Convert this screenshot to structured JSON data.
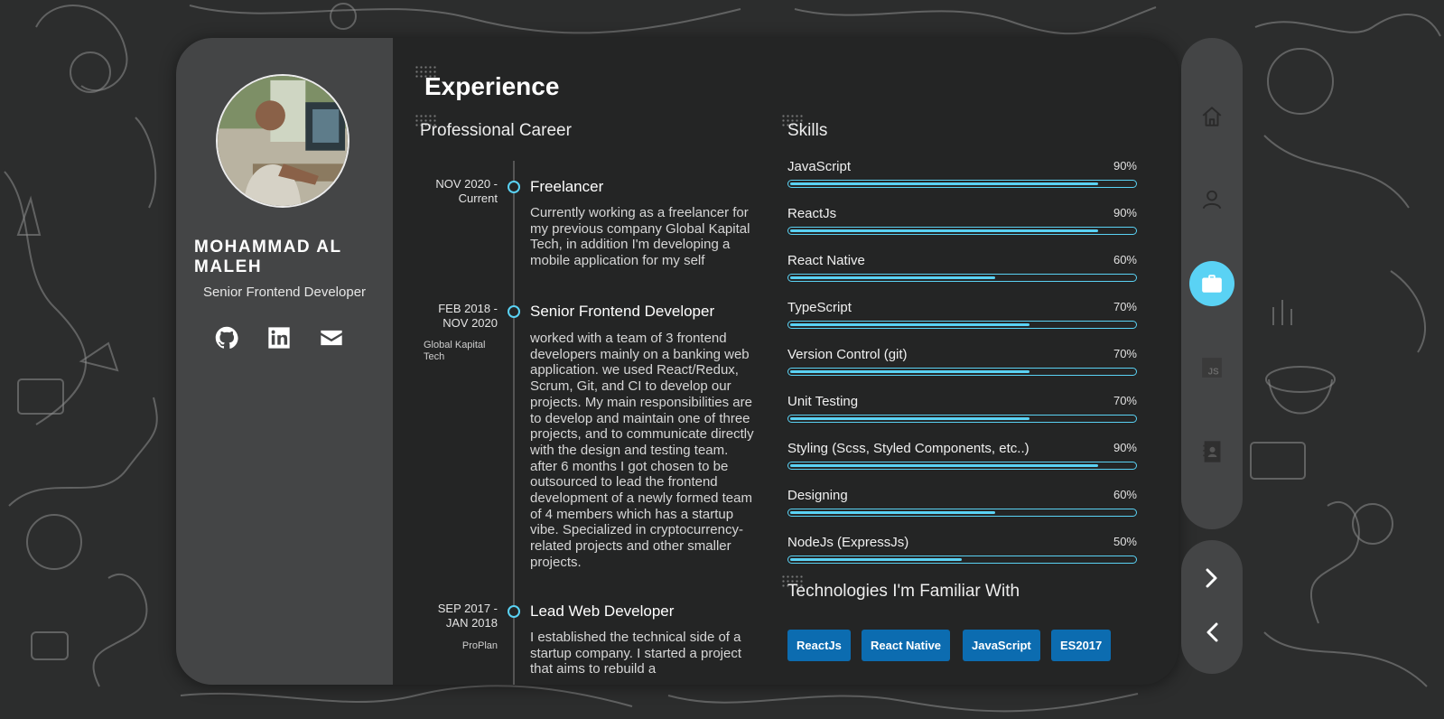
{
  "profile": {
    "name": "MOHAMMAD AL MALEH",
    "role": "Senior Frontend Developer",
    "socials": [
      "github-icon",
      "linkedin-icon",
      "mail-icon"
    ]
  },
  "experience": {
    "title": "Experience",
    "career_title": "Professional Career",
    "items": [
      {
        "date": "NOV 2020 - Current",
        "company": "",
        "title": "Freelancer",
        "desc": "Currently working as a freelancer for my previous company Global Kapital Tech, in addition I'm developing a mobile application for my self"
      },
      {
        "date": "FEB 2018 - NOV 2020",
        "company": "Global Kapital Tech",
        "title": "Senior Frontend Developer",
        "desc": "worked with a team of 3 frontend developers mainly on a banking web application. we used React/Redux, Scrum, Git, and CI to develop our projects. My main responsibilities are to develop and maintain one of three projects, and to communicate directly with the design and testing team. after 6 months I got chosen to be outsourced to lead the frontend development of a newly formed team of 4 members which has a startup vibe. Specialized in cryptocurrency-related projects and other smaller projects."
      },
      {
        "date": "SEP 2017 - JAN 2018",
        "company": "ProPlan",
        "title": "Lead Web Developer",
        "desc": "I established the technical side of a startup company. I started a project that aims to rebuild a"
      }
    ]
  },
  "skills": {
    "title": "Skills",
    "items": [
      {
        "name": "JavaScript",
        "percent": "90%",
        "level": 0.9
      },
      {
        "name": "ReactJs",
        "percent": "90%",
        "level": 0.9
      },
      {
        "name": "React Native",
        "percent": "60%",
        "level": 0.6
      },
      {
        "name": "TypeScript",
        "percent": "70%",
        "level": 0.7
      },
      {
        "name": "Version Control (git)",
        "percent": "70%",
        "level": 0.7
      },
      {
        "name": "Unit Testing",
        "percent": "70%",
        "level": 0.7
      },
      {
        "name": "Styling (Scss, Styled Components, etc..)",
        "percent": "90%",
        "level": 0.9
      },
      {
        "name": "Designing",
        "percent": "60%",
        "level": 0.6
      },
      {
        "name": "NodeJs (ExpressJs)",
        "percent": "50%",
        "level": 0.5
      }
    ]
  },
  "technologies": {
    "title": "Technologies I'm Familiar With",
    "tags": [
      "ReactJs",
      "React Native",
      "JavaScript",
      "ES2017"
    ]
  },
  "nav": {
    "items": [
      {
        "icon": "home-icon",
        "active": false
      },
      {
        "icon": "user-icon",
        "active": false
      },
      {
        "icon": "briefcase-icon",
        "active": true
      },
      {
        "icon": "js-icon",
        "active": false,
        "label": "JS"
      },
      {
        "icon": "contact-book-icon",
        "active": false
      }
    ],
    "arrows": [
      "chevron-right-icon",
      "chevron-left-icon"
    ]
  },
  "colors": {
    "accent": "#5ad2f4",
    "tag_bg": "#0c6cb0",
    "panel": "#444546",
    "card": "#242525",
    "background": "#2c2d2d"
  }
}
